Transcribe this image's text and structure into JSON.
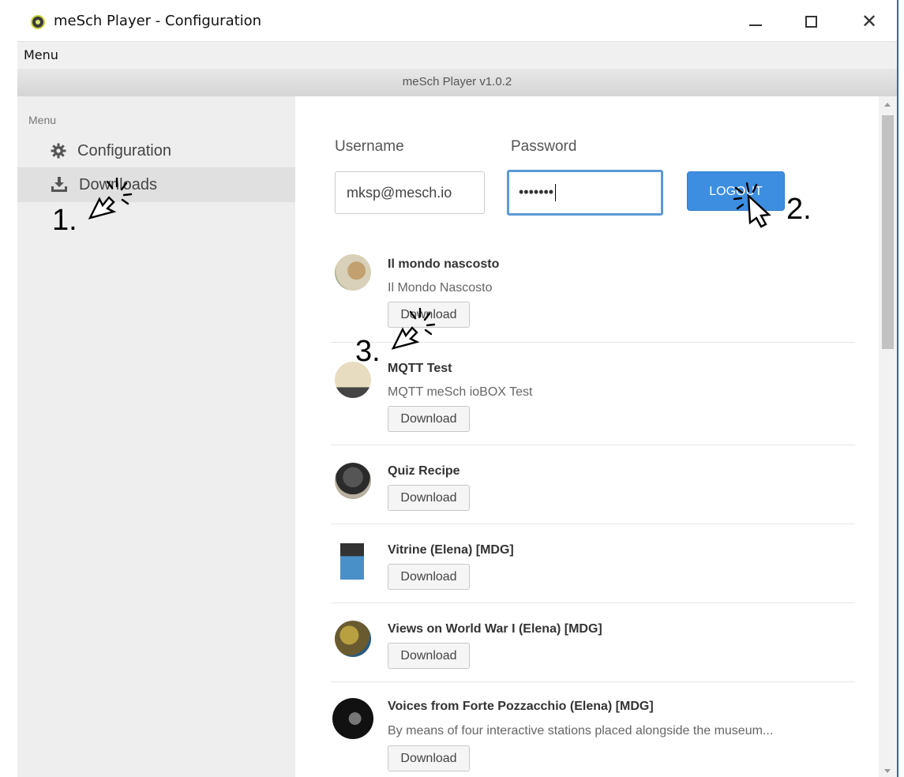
{
  "window": {
    "title": "meSch Player - Configuration",
    "minimize_glyph": "—",
    "maximize_glyph": "☐",
    "close_glyph": "✕"
  },
  "menubar": {
    "menu_label": "Menu"
  },
  "version_bar": {
    "text": "meSch Player v1.0.2"
  },
  "sidebar": {
    "heading": "Menu",
    "items": [
      {
        "label": "Configuration",
        "icon": "gear-icon"
      },
      {
        "label": "Downloads",
        "icon": "download-icon",
        "selected": true
      }
    ]
  },
  "login": {
    "username_label": "Username",
    "password_label": "Password",
    "username_value": "mksp@mesch.io",
    "password_value": "•••••••",
    "logout_label": "LOGOUT"
  },
  "downloads": [
    {
      "title": "Il mondo nascosto",
      "description": "Il Mondo Nascosto",
      "button": "Download"
    },
    {
      "title": "MQTT Test",
      "description": "MQTT meSch ioBOX Test",
      "button": "Download"
    },
    {
      "title": "Quiz Recipe",
      "description": "",
      "button": "Download"
    },
    {
      "title": "Vitrine (Elena) [MDG]",
      "description": "",
      "button": "Download"
    },
    {
      "title": "Views on World War I (Elena) [MDG]",
      "description": "",
      "button": "Download"
    },
    {
      "title": "Voices from Forte Pozzacchio (Elena) [MDG]",
      "description": "By means of four interactive stations placed alongside the museum...",
      "button": "Download"
    }
  ],
  "annotations": [
    "1.",
    "2.",
    "3."
  ],
  "colors": {
    "accent": "#3d8ee0",
    "sidebar_bg": "#eeeeee",
    "selected_bg": "#e0e0e0"
  }
}
